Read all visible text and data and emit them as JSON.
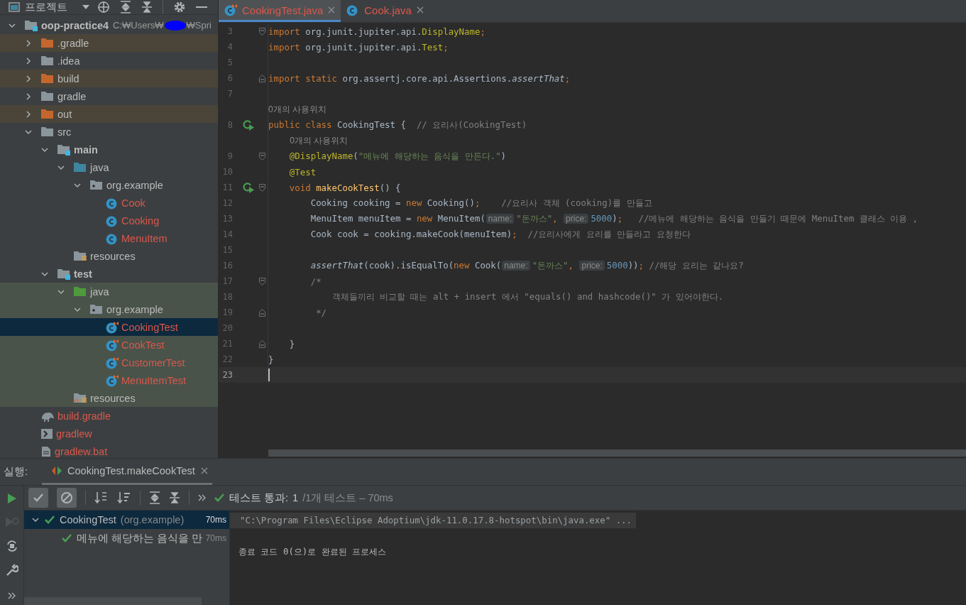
{
  "project_panel": {
    "title": "프로젝트",
    "tree": [
      {
        "label": "oop-practice4",
        "kind": "module",
        "path": "C:₩Users₩",
        "path_tail": "₩Spri",
        "excluded": false,
        "test_scope": false,
        "selected": false,
        "unversioned": false,
        "expanded": true,
        "children": [
          {
            "label": ".gradle",
            "kind": "folder-excluded",
            "excluded": true,
            "test_scope": false,
            "selected": false,
            "unversioned": false,
            "expanded": false
          },
          {
            "label": ".idea",
            "kind": "folder",
            "excluded": false,
            "test_scope": false,
            "selected": false,
            "unversioned": false,
            "expanded": false
          },
          {
            "label": "build",
            "kind": "folder-excluded",
            "excluded": true,
            "test_scope": false,
            "selected": false,
            "unversioned": false,
            "expanded": false
          },
          {
            "label": "gradle",
            "kind": "folder",
            "excluded": false,
            "test_scope": false,
            "selected": false,
            "unversioned": false,
            "expanded": false
          },
          {
            "label": "out",
            "kind": "folder-excluded",
            "excluded": true,
            "test_scope": false,
            "selected": false,
            "unversioned": false,
            "expanded": false
          },
          {
            "label": "src",
            "kind": "folder",
            "excluded": false,
            "test_scope": false,
            "selected": false,
            "unversioned": false,
            "expanded": true,
            "children": [
              {
                "label": "main",
                "kind": "module",
                "excluded": false,
                "test_scope": false,
                "selected": false,
                "unversioned": false,
                "expanded": true,
                "children": [
                  {
                    "label": "java",
                    "kind": "source-root",
                    "excluded": false,
                    "test_scope": false,
                    "selected": false,
                    "unversioned": false,
                    "expanded": true,
                    "children": [
                      {
                        "label": "org.example",
                        "kind": "package",
                        "excluded": false,
                        "test_scope": false,
                        "selected": false,
                        "unversioned": false,
                        "expanded": true,
                        "children": [
                          {
                            "label": "Cook",
                            "kind": "class",
                            "excluded": false,
                            "test_scope": false,
                            "selected": false,
                            "unversioned": true
                          },
                          {
                            "label": "Cooking",
                            "kind": "class",
                            "excluded": false,
                            "test_scope": false,
                            "selected": false,
                            "unversioned": true
                          },
                          {
                            "label": "MenuItem",
                            "kind": "class",
                            "excluded": false,
                            "test_scope": false,
                            "selected": false,
                            "unversioned": true
                          }
                        ]
                      }
                    ]
                  },
                  {
                    "label": "resources",
                    "kind": "resources",
                    "excluded": false,
                    "test_scope": false,
                    "selected": false,
                    "unversioned": false
                  }
                ]
              },
              {
                "label": "test",
                "kind": "module",
                "excluded": false,
                "test_scope": false,
                "selected": false,
                "unversioned": false,
                "expanded": true,
                "children": [
                  {
                    "label": "java",
                    "kind": "test-root",
                    "excluded": false,
                    "test_scope": true,
                    "selected": false,
                    "unversioned": false,
                    "expanded": true,
                    "children": [
                      {
                        "label": "org.example",
                        "kind": "package",
                        "excluded": false,
                        "test_scope": true,
                        "selected": false,
                        "unversioned": false,
                        "expanded": true,
                        "children": [
                          {
                            "label": "CookingTest",
                            "kind": "test-class",
                            "excluded": false,
                            "test_scope": true,
                            "selected": true,
                            "unversioned": true
                          },
                          {
                            "label": "CookTest",
                            "kind": "test-class",
                            "excluded": false,
                            "test_scope": true,
                            "selected": false,
                            "unversioned": true
                          },
                          {
                            "label": "CustomerTest",
                            "kind": "test-class",
                            "excluded": false,
                            "test_scope": true,
                            "selected": false,
                            "unversioned": true
                          },
                          {
                            "label": "MenuItemTest",
                            "kind": "test-class",
                            "excluded": false,
                            "test_scope": true,
                            "selected": false,
                            "unversioned": true
                          }
                        ]
                      }
                    ]
                  },
                  {
                    "label": "resources",
                    "kind": "test-resources",
                    "excluded": false,
                    "test_scope": true,
                    "selected": false,
                    "unversioned": false
                  }
                ]
              }
            ]
          },
          {
            "label": "build.gradle",
            "kind": "gradle-file",
            "excluded": false,
            "test_scope": false,
            "selected": false,
            "unversioned": true
          },
          {
            "label": "gradlew",
            "kind": "script-file",
            "excluded": false,
            "test_scope": false,
            "selected": false,
            "unversioned": true
          },
          {
            "label": "gradlew.bat",
            "kind": "bat-file",
            "excluded": false,
            "test_scope": false,
            "selected": false,
            "unversioned": true
          }
        ]
      }
    ]
  },
  "editor": {
    "tabs": [
      {
        "label": "CookingTest.java",
        "kind": "test-class",
        "selected": true
      },
      {
        "label": "Cook.java",
        "kind": "class",
        "selected": false
      }
    ],
    "lines": [
      {
        "kind": "code",
        "num": "3",
        "run_marker": false,
        "fold_start": true,
        "fold_end": false,
        "current": false,
        "tokens": [
          {
            "kind": "kw",
            "t": "import"
          },
          {
            "kind": "pl",
            "t": " org.junit.jupiter.api."
          },
          {
            "kind": "ann",
            "t": "DisplayName"
          },
          {
            "kind": "kw",
            "t": ";"
          }
        ]
      },
      {
        "kind": "code",
        "num": "4",
        "run_marker": false,
        "fold_start": false,
        "fold_end": false,
        "current": false,
        "tokens": [
          {
            "kind": "kw",
            "t": "import"
          },
          {
            "kind": "pl",
            "t": " org.junit.jupiter.api."
          },
          {
            "kind": "ann",
            "t": "Test"
          },
          {
            "kind": "kw",
            "t": ";"
          }
        ]
      },
      {
        "kind": "code",
        "num": "5",
        "run_marker": false,
        "fold_start": false,
        "fold_end": false,
        "current": false
      },
      {
        "kind": "code",
        "num": "6",
        "run_marker": false,
        "fold_start": false,
        "fold_end": true,
        "current": false,
        "tokens": [
          {
            "kind": "kw",
            "t": "import static"
          },
          {
            "kind": "pl",
            "t": " org.assertj.core.api.Assertions."
          },
          {
            "kind": "it",
            "t": "assertThat"
          },
          {
            "kind": "kw",
            "t": ";"
          }
        ]
      },
      {
        "kind": "code",
        "num": "7",
        "run_marker": false,
        "fold_start": false,
        "fold_end": false,
        "current": false
      },
      {
        "kind": "usage",
        "text": "0개의 사용위치"
      },
      {
        "kind": "code",
        "num": "8",
        "run_marker": true,
        "fold_start": false,
        "fold_end": false,
        "current": false,
        "tokens": [
          {
            "kind": "kw",
            "t": "public class "
          },
          {
            "kind": "pl",
            "t": "CookingTest {  "
          },
          {
            "kind": "cmt",
            "t": "// 요리사(CookingTest)"
          }
        ]
      },
      {
        "kind": "usage",
        "text": "0개의 사용위치"
      },
      {
        "kind": "code",
        "num": "9",
        "run_marker": false,
        "fold_start": true,
        "fold_end": false,
        "current": false,
        "tokens": [
          {
            "kind": "ann",
            "t": "    @DisplayName"
          },
          {
            "kind": "pl",
            "t": "("
          },
          {
            "kind": "str",
            "t": "\"메뉴에 해당하는 음식을 만든다.\""
          },
          {
            "kind": "pl",
            "t": ")"
          }
        ]
      },
      {
        "kind": "code",
        "num": "10",
        "run_marker": false,
        "fold_start": false,
        "fold_end": false,
        "current": false,
        "tokens": [
          {
            "kind": "ann",
            "t": "    @Test"
          }
        ]
      },
      {
        "kind": "code",
        "num": "11",
        "run_marker": true,
        "fold_start": true,
        "fold_end": false,
        "current": false,
        "tokens": [
          {
            "kind": "kw",
            "t": "    void "
          },
          {
            "kind": "fn",
            "t": "makeCookTest"
          },
          {
            "kind": "pl",
            "t": "() {"
          }
        ]
      },
      {
        "kind": "code",
        "num": "12",
        "run_marker": false,
        "fold_start": false,
        "fold_end": false,
        "current": false,
        "tokens": [
          {
            "kind": "pl",
            "t": "        Cooking cooking = "
          },
          {
            "kind": "kw",
            "t": "new "
          },
          {
            "kind": "pl",
            "t": "Cooking()"
          },
          {
            "kind": "kw",
            "t": ";"
          },
          {
            "kind": "cmt",
            "t": "    //요리사 객체 (cooking)를 만들고"
          }
        ]
      },
      {
        "kind": "code",
        "num": "13",
        "run_marker": false,
        "fold_start": false,
        "fold_end": false,
        "current": false,
        "tokens": [
          {
            "kind": "pl",
            "t": "        MenuItem menuItem = "
          },
          {
            "kind": "kw",
            "t": "new "
          },
          {
            "kind": "pl",
            "t": "MenuItem("
          },
          {
            "kind": "hint",
            "t": "name:"
          },
          {
            "kind": "str",
            "t": "\"돈까스\""
          },
          {
            "kind": "kw",
            "t": ", "
          },
          {
            "kind": "hint",
            "t": "price:"
          },
          {
            "kind": "num",
            "t": "5000"
          },
          {
            "kind": "pl",
            "t": ")"
          },
          {
            "kind": "kw",
            "t": ";"
          },
          {
            "kind": "cmt",
            "t": "   //메뉴에 해당하는 음식을 만들기 때문에 MenuItem 클래스 이용 ,"
          }
        ]
      },
      {
        "kind": "code",
        "num": "14",
        "run_marker": false,
        "fold_start": false,
        "fold_end": false,
        "current": false,
        "tokens": [
          {
            "kind": "pl",
            "t": "        Cook cook = cooking.makeCook(menuItem)"
          },
          {
            "kind": "kw",
            "t": ";"
          },
          {
            "kind": "cmt",
            "t": "  //요리사에게 요리를 만들라고 요청한다"
          }
        ]
      },
      {
        "kind": "code",
        "num": "15",
        "run_marker": false,
        "fold_start": false,
        "fold_end": false,
        "current": false
      },
      {
        "kind": "code",
        "num": "16",
        "run_marker": false,
        "fold_start": false,
        "fold_end": false,
        "current": false,
        "tokens": [
          {
            "kind": "it",
            "t": "        assertThat"
          },
          {
            "kind": "pl",
            "t": "(cook).isEqualTo("
          },
          {
            "kind": "kw",
            "t": "new "
          },
          {
            "kind": "pl",
            "t": "Cook("
          },
          {
            "kind": "hint",
            "t": "name:"
          },
          {
            "kind": "str",
            "t": "\"돈까스\""
          },
          {
            "kind": "kw",
            "t": ", "
          },
          {
            "kind": "hint",
            "t": "price:"
          },
          {
            "kind": "num",
            "t": "5000"
          },
          {
            "kind": "pl",
            "t": "))"
          },
          {
            "kind": "kw",
            "t": ";"
          },
          {
            "kind": "cmt",
            "t": " //해당 요리는 같나요?"
          }
        ]
      },
      {
        "kind": "code",
        "num": "17",
        "run_marker": false,
        "fold_start": true,
        "fold_end": false,
        "current": false,
        "tokens": [
          {
            "kind": "cmt",
            "t": "        /*"
          }
        ]
      },
      {
        "kind": "code",
        "num": "18",
        "run_marker": false,
        "fold_start": false,
        "fold_end": false,
        "current": false,
        "tokens": [
          {
            "kind": "cmt",
            "t": "            객체들끼리 비교할 때는 alt + insert 에서 \"equals() and hashcode()\" 가 있어야한다."
          }
        ]
      },
      {
        "kind": "code",
        "num": "19",
        "run_marker": false,
        "fold_start": false,
        "fold_end": true,
        "current": false,
        "tokens": [
          {
            "kind": "cmt",
            "t": "         */"
          }
        ]
      },
      {
        "kind": "code",
        "num": "20",
        "run_marker": false,
        "fold_start": false,
        "fold_end": false,
        "current": false
      },
      {
        "kind": "code",
        "num": "21",
        "run_marker": false,
        "fold_start": false,
        "fold_end": true,
        "current": false,
        "tokens": [
          {
            "kind": "pl",
            "t": "    }"
          }
        ]
      },
      {
        "kind": "code",
        "num": "22",
        "run_marker": false,
        "fold_start": false,
        "fold_end": false,
        "current": false,
        "tokens": [
          {
            "kind": "pl",
            "t": "}"
          }
        ]
      },
      {
        "kind": "code",
        "num": "23",
        "run_marker": false,
        "fold_start": false,
        "fold_end": false,
        "current": true
      }
    ]
  },
  "run_panel": {
    "label": "실행:",
    "tab": {
      "label": "CookingTest.makeCookTest",
      "selected": true
    },
    "toggles": [
      {
        "kind": "passed",
        "selected": true
      },
      {
        "kind": "ignored",
        "selected": true
      }
    ],
    "status": {
      "title": "테스트 통과:",
      "count": "1",
      "detail": "/1개 테스트 – 70ms"
    },
    "tests": [
      {
        "label": "CookingTest",
        "package": "(org.example)",
        "time": "70ms",
        "selected": true,
        "expanded": true,
        "children": [
          {
            "label": "메뉴에 해당하는 음식을 만",
            "time": "70ms",
            "selected": false
          }
        ]
      }
    ],
    "console": [
      {
        "text": "\"C:\\Program Files\\Eclipse Adoptium\\jdk-11.0.17.8-hotspot\\bin\\java.exe\" ...",
        "highlighted": true
      },
      {
        "text": "종료 코드 0(으)로 완료된 프로세스",
        "highlighted": false
      }
    ]
  }
}
